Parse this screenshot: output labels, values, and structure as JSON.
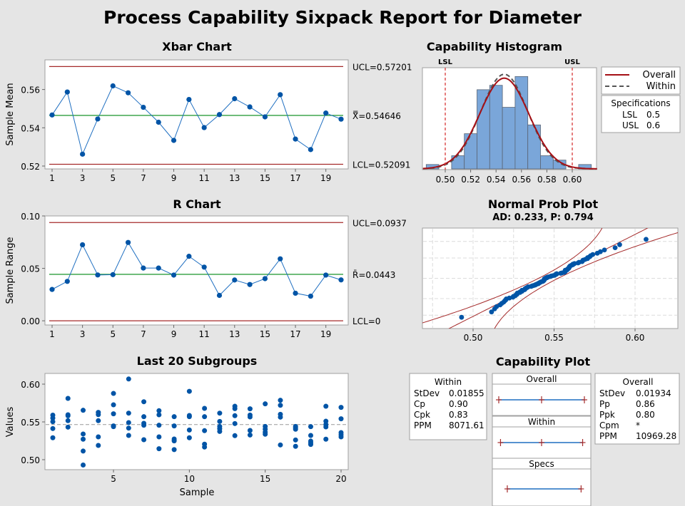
{
  "title": "Process Capability Sixpack Report for Diameter",
  "colors": {
    "background": "#e5e5e5",
    "point": "#0054a6",
    "line": "#1f6fc1",
    "limit": "#a52a2a",
    "center": "#2e9e3e",
    "bar": "#7aa6d9",
    "bar_edge": "#5a6575",
    "fit_overall": "#a50f15",
    "fit_within": "#555555",
    "spec": "#d93a3a"
  },
  "chart_data": [
    {
      "id": "xbar",
      "type": "line",
      "title": "Xbar Chart",
      "xlabel": "",
      "ylabel": "Sample Mean",
      "x": [
        1,
        2,
        3,
        4,
        5,
        6,
        7,
        8,
        9,
        10,
        11,
        12,
        13,
        14,
        15,
        16,
        17,
        18,
        19,
        20
      ],
      "xticks": [
        1,
        3,
        5,
        7,
        9,
        11,
        13,
        15,
        17,
        19
      ],
      "yticks": [
        0.52,
        0.54,
        0.56
      ],
      "ytick_labels": [
        "0.52",
        "0.54",
        "0.56"
      ],
      "ylim": [
        0.5185,
        0.5755
      ],
      "values": [
        0.5467,
        0.5587,
        0.5262,
        0.5446,
        0.5619,
        0.5583,
        0.5507,
        0.5429,
        0.5334,
        0.5548,
        0.5401,
        0.5469,
        0.5552,
        0.5509,
        0.5457,
        0.5573,
        0.5341,
        0.5286,
        0.5477,
        0.5445
      ],
      "ucl": 0.57201,
      "center": 0.54646,
      "lcl": 0.52091,
      "ucl_label": "UCL=0.57201",
      "center_label": "X̿=0.54646",
      "lcl_label": "LCL=0.52091"
    },
    {
      "id": "rchart",
      "type": "line",
      "title": "R Chart",
      "xlabel": "",
      "ylabel": "Sample Range",
      "x": [
        1,
        2,
        3,
        4,
        5,
        6,
        7,
        8,
        9,
        10,
        11,
        12,
        13,
        14,
        15,
        16,
        17,
        18,
        19,
        20
      ],
      "xticks": [
        1,
        3,
        5,
        7,
        9,
        11,
        13,
        15,
        17,
        19
      ],
      "yticks": [
        0.0,
        0.05,
        0.1
      ],
      "ytick_labels": [
        "0.00",
        "0.05",
        "0.10"
      ],
      "ylim": [
        -0.004,
        0.1
      ],
      "values": [
        0.0299,
        0.0376,
        0.0725,
        0.0437,
        0.044,
        0.0747,
        0.0503,
        0.0503,
        0.0436,
        0.0615,
        0.0512,
        0.0242,
        0.0389,
        0.0346,
        0.0402,
        0.0591,
        0.0263,
        0.0235,
        0.0436,
        0.039
      ],
      "ucl": 0.0937,
      "center": 0.0443,
      "lcl": 0,
      "ucl_label": "UCL=0.0937",
      "center_label": "R̄=0.0443",
      "lcl_label": "LCL=0"
    },
    {
      "id": "subgroups",
      "type": "scatter",
      "title": "Last 20 Subgroups",
      "xlabel": "Sample",
      "ylabel": "Values",
      "xticks": [
        5,
        10,
        15,
        20
      ],
      "yticks": [
        0.5,
        0.55,
        0.6
      ],
      "ytick_labels": [
        "0.50",
        "0.55",
        "0.60"
      ],
      "xlim": [
        0.2,
        20.5
      ],
      "ylim": [
        0.487,
        0.614
      ],
      "reference_line": 0.54646,
      "groups": [
        [
          0.559,
          0.555,
          0.5503,
          0.5412,
          0.529
        ],
        [
          0.5811,
          0.5594,
          0.5581,
          0.5516,
          0.5431
        ],
        [
          0.5654,
          0.534,
          0.5271,
          0.5114,
          0.4929
        ],
        [
          0.5626,
          0.5597,
          0.5516,
          0.5302,
          0.5189
        ],
        [
          0.5877,
          0.5726,
          0.5607,
          0.5447,
          0.5437
        ],
        [
          0.6068,
          0.5616,
          0.5491,
          0.5418,
          0.5321
        ],
        [
          0.5767,
          0.5569,
          0.5481,
          0.5456,
          0.5264
        ],
        [
          0.5648,
          0.5594,
          0.5456,
          0.5302,
          0.5145
        ],
        [
          0.5569,
          0.5447,
          0.5274,
          0.5249,
          0.5133
        ],
        [
          0.5905,
          0.5585,
          0.5569,
          0.5393,
          0.529
        ],
        [
          0.5679,
          0.5569,
          0.5384,
          0.5205,
          0.5167
        ],
        [
          0.5616,
          0.5506,
          0.544,
          0.5409,
          0.5374
        ],
        [
          0.5707,
          0.5676,
          0.5582,
          0.5478,
          0.5318
        ],
        [
          0.5673,
          0.5591,
          0.5566,
          0.5387,
          0.5327
        ],
        [
          0.5739,
          0.544,
          0.5403,
          0.5365,
          0.5337
        ],
        [
          0.5786,
          0.572,
          0.56,
          0.5563,
          0.5195
        ],
        [
          0.544,
          0.5422,
          0.5403,
          0.5261,
          0.5177
        ],
        [
          0.5437,
          0.5321,
          0.5246,
          0.5224,
          0.5202
        ],
        [
          0.5707,
          0.5509,
          0.5465,
          0.5434,
          0.5271
        ],
        [
          0.5692,
          0.5541,
          0.5359,
          0.533,
          0.5302
        ]
      ]
    },
    {
      "id": "histogram",
      "type": "bar",
      "title": "Capability Histogram",
      "bin_start": 0.485,
      "bin_width": 0.01,
      "counts": [
        1,
        0,
        3,
        8,
        18,
        19,
        14,
        21,
        10,
        3,
        2,
        0,
        1
      ],
      "xticks": [
        0.5,
        0.52,
        0.54,
        0.56,
        0.58,
        0.6
      ],
      "xtick_labels": [
        "0.50",
        "0.52",
        "0.54",
        "0.56",
        "0.58",
        "0.60"
      ],
      "xlim": [
        0.4825,
        0.6195
      ],
      "ymax": 23,
      "mean": 0.54646,
      "sd_overall": 0.01934,
      "sd_within": 0.01855,
      "lsl": 0.5,
      "usl": 0.6,
      "lsl_label": "LSL",
      "usl_label": "USL",
      "legend": {
        "overall": "Overall",
        "within": "Within",
        "spec_title": "Specifications",
        "spec_rows": [
          [
            "LSL",
            "0.5"
          ],
          [
            "USL",
            "0.6"
          ]
        ]
      }
    },
    {
      "id": "normprob",
      "type": "scatter",
      "title": "Normal Prob Plot",
      "subtitle": "AD: 0.233, P: 0.794",
      "xticks": [
        0.5,
        0.55,
        0.6
      ],
      "xtick_labels": [
        "0.50",
        "0.55",
        "0.60"
      ],
      "xgrid": [
        0.475,
        0.5,
        0.525,
        0.55,
        0.575,
        0.6
      ],
      "ygrid_percent": [
        1,
        10,
        50,
        90,
        99
      ],
      "xlim": [
        0.4705,
        0.6285
      ],
      "mean": 0.54646,
      "sd": 0.01934
    },
    {
      "id": "capability",
      "type": "table",
      "title": "Capability Plot",
      "within": {
        "title": "Within",
        "rows": [
          [
            "StDev",
            "0.01855"
          ],
          [
            "Cp",
            "0.90"
          ],
          [
            "Cpk",
            "0.83"
          ],
          [
            "PPM",
            "8071.61"
          ]
        ]
      },
      "overall": {
        "title": "Overall",
        "rows": [
          [
            "StDev",
            "0.01934"
          ],
          [
            "Pp",
            "0.86"
          ],
          [
            "Ppk",
            "0.80"
          ],
          [
            "Cpm",
            "*"
          ],
          [
            "PPM",
            "10969.28"
          ]
        ]
      },
      "intervals": [
        {
          "label": "Overall",
          "low": 0.48844,
          "mid": 0.54646,
          "high": 0.60448
        },
        {
          "label": "Within",
          "low": 0.49081,
          "mid": 0.54646,
          "high": 0.60211
        },
        {
          "label": "Specs",
          "low": 0.5,
          "high": 0.6
        }
      ],
      "xlim": [
        0.478,
        0.612
      ]
    }
  ]
}
